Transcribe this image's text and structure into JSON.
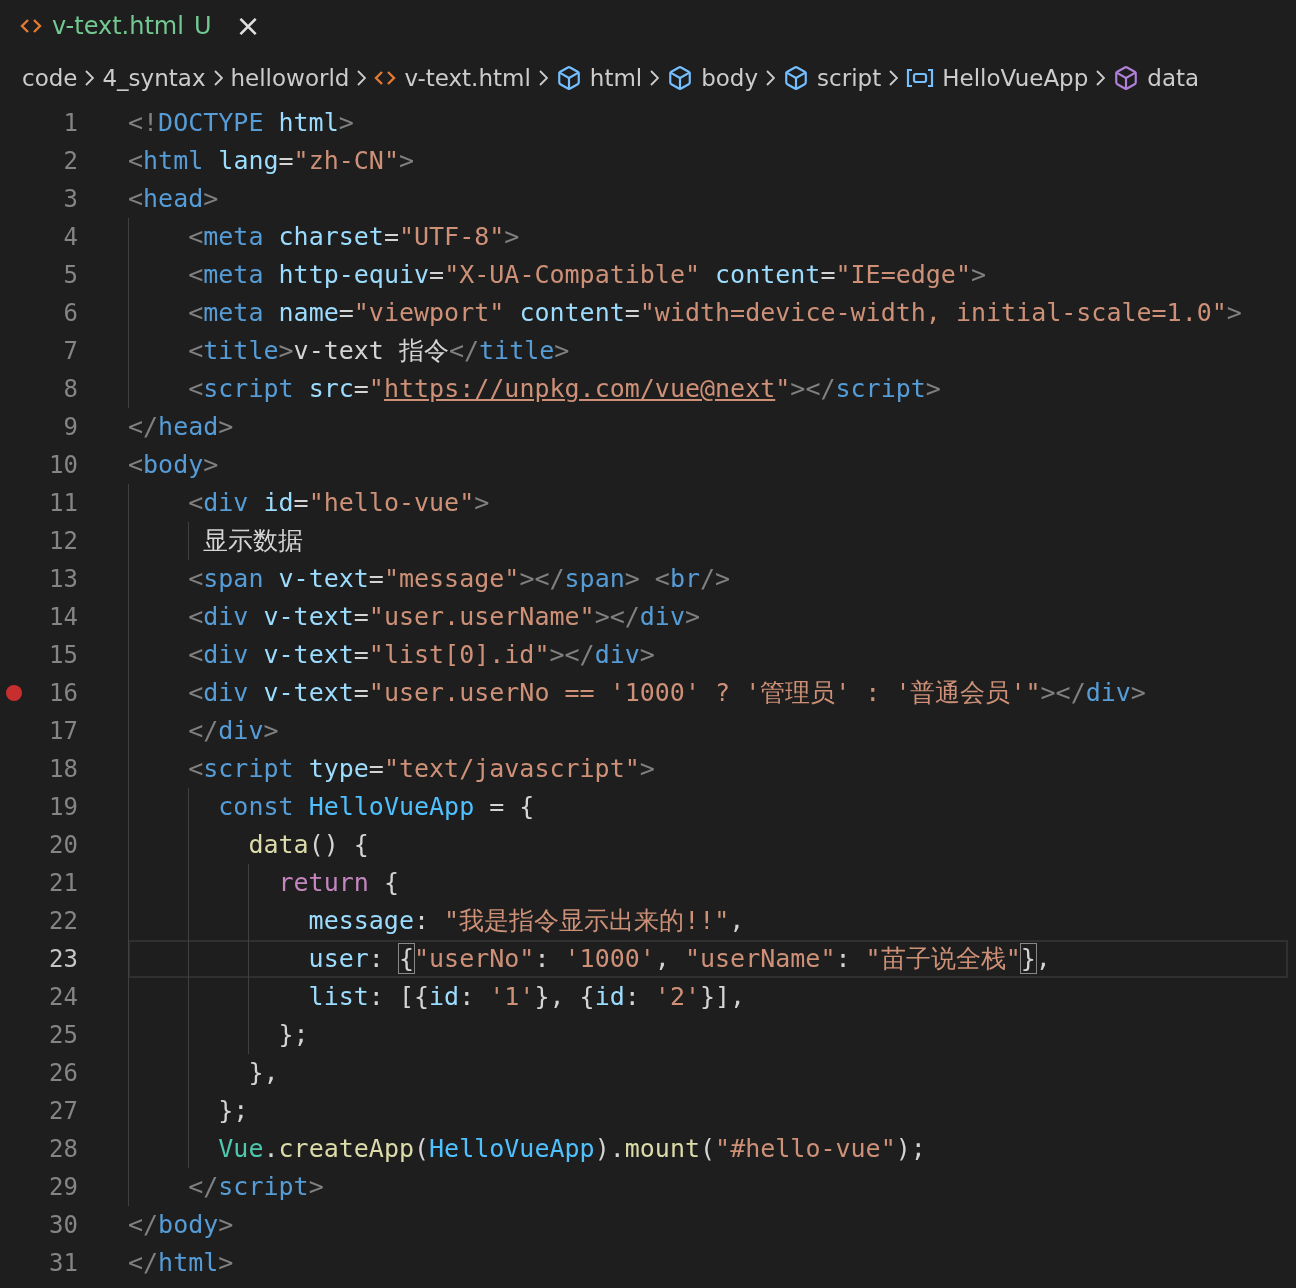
{
  "tab": {
    "label": "v-text.html",
    "status": "U",
    "close": "×",
    "selected": true
  },
  "breadcrumbs": [
    {
      "kind": "folder",
      "label": "code"
    },
    {
      "kind": "folder",
      "label": "4_syntax"
    },
    {
      "kind": "folder",
      "label": "helloworld"
    },
    {
      "kind": "file",
      "label": "v-text.html"
    },
    {
      "kind": "element",
      "label": "html"
    },
    {
      "kind": "element",
      "label": "body"
    },
    {
      "kind": "element",
      "label": "script"
    },
    {
      "kind": "variable",
      "label": "HelloVueApp"
    },
    {
      "kind": "method",
      "label": "data"
    }
  ],
  "lines": [
    {
      "number": "1",
      "breakpoint": false,
      "current": false,
      "tokens": [
        {
          "kind": "punct",
          "text": "<!"
        },
        {
          "kind": "tag",
          "text": "DOCTYPE"
        },
        {
          "kind": "attr",
          "text": " html"
        },
        {
          "kind": "punct",
          "text": ">"
        }
      ]
    },
    {
      "number": "2",
      "breakpoint": false,
      "current": false,
      "tokens": [
        {
          "kind": "punct",
          "text": "<"
        },
        {
          "kind": "tag",
          "text": "html"
        },
        {
          "kind": "attr",
          "text": " lang"
        },
        {
          "kind": "op",
          "text": "="
        },
        {
          "kind": "str",
          "text": "\"zh-CN\""
        },
        {
          "kind": "punct",
          "text": ">"
        }
      ]
    },
    {
      "number": "3",
      "breakpoint": false,
      "current": false,
      "tokens": [
        {
          "kind": "punct",
          "text": "<"
        },
        {
          "kind": "tag",
          "text": "head"
        },
        {
          "kind": "punct",
          "text": ">"
        }
      ]
    },
    {
      "number": "4",
      "breakpoint": false,
      "current": false,
      "tokens": [
        {
          "kind": "punct",
          "text": "    <"
        },
        {
          "kind": "tag",
          "text": "meta"
        },
        {
          "kind": "attr",
          "text": " charset"
        },
        {
          "kind": "op",
          "text": "="
        },
        {
          "kind": "str",
          "text": "\"UTF-8\""
        },
        {
          "kind": "punct",
          "text": ">"
        }
      ]
    },
    {
      "number": "5",
      "breakpoint": false,
      "current": false,
      "tokens": [
        {
          "kind": "punct",
          "text": "    <"
        },
        {
          "kind": "tag",
          "text": "meta"
        },
        {
          "kind": "attr",
          "text": " http-equiv"
        },
        {
          "kind": "op",
          "text": "="
        },
        {
          "kind": "str",
          "text": "\"X-UA-Compatible\""
        },
        {
          "kind": "attr",
          "text": " content"
        },
        {
          "kind": "op",
          "text": "="
        },
        {
          "kind": "str",
          "text": "\"IE=edge\""
        },
        {
          "kind": "punct",
          "text": ">"
        }
      ]
    },
    {
      "number": "6",
      "breakpoint": false,
      "current": false,
      "tokens": [
        {
          "kind": "punct",
          "text": "    <"
        },
        {
          "kind": "tag",
          "text": "meta"
        },
        {
          "kind": "attr",
          "text": " name"
        },
        {
          "kind": "op",
          "text": "="
        },
        {
          "kind": "str",
          "text": "\"viewport\""
        },
        {
          "kind": "attr",
          "text": " content"
        },
        {
          "kind": "op",
          "text": "="
        },
        {
          "kind": "str",
          "text": "\"width=device-width, initial-scale=1.0\""
        },
        {
          "kind": "punct",
          "text": ">"
        }
      ]
    },
    {
      "number": "7",
      "breakpoint": false,
      "current": false,
      "tokens": [
        {
          "kind": "punct",
          "text": "    <"
        },
        {
          "kind": "tag",
          "text": "title"
        },
        {
          "kind": "punct",
          "text": ">"
        },
        {
          "kind": "text",
          "text": "v-text 指令"
        },
        {
          "kind": "punct",
          "text": "</"
        },
        {
          "kind": "tag",
          "text": "title"
        },
        {
          "kind": "punct",
          "text": ">"
        }
      ]
    },
    {
      "number": "8",
      "breakpoint": false,
      "current": false,
      "tokens": [
        {
          "kind": "punct",
          "text": "    <"
        },
        {
          "kind": "tag",
          "text": "script"
        },
        {
          "kind": "attr",
          "text": " src"
        },
        {
          "kind": "op",
          "text": "="
        },
        {
          "kind": "str",
          "text": "\""
        },
        {
          "kind": "link",
          "text": "https://unpkg.com/vue@next"
        },
        {
          "kind": "str",
          "text": "\""
        },
        {
          "kind": "punct",
          "text": "></"
        },
        {
          "kind": "tag",
          "text": "script"
        },
        {
          "kind": "punct",
          "text": ">"
        }
      ]
    },
    {
      "number": "9",
      "breakpoint": false,
      "current": false,
      "tokens": [
        {
          "kind": "punct",
          "text": "</"
        },
        {
          "kind": "tag",
          "text": "head"
        },
        {
          "kind": "punct",
          "text": ">"
        }
      ]
    },
    {
      "number": "10",
      "breakpoint": false,
      "current": false,
      "tokens": [
        {
          "kind": "punct",
          "text": "<"
        },
        {
          "kind": "tag",
          "text": "body"
        },
        {
          "kind": "punct",
          "text": ">"
        }
      ]
    },
    {
      "number": "11",
      "breakpoint": false,
      "current": false,
      "tokens": [
        {
          "kind": "punct",
          "text": "    <"
        },
        {
          "kind": "tag",
          "text": "div"
        },
        {
          "kind": "attr",
          "text": " id"
        },
        {
          "kind": "op",
          "text": "="
        },
        {
          "kind": "str",
          "text": "\"hello-vue\""
        },
        {
          "kind": "punct",
          "text": ">"
        }
      ]
    },
    {
      "number": "12",
      "breakpoint": false,
      "current": false,
      "tokens": [
        {
          "kind": "text",
          "text": "     显示数据"
        }
      ]
    },
    {
      "number": "13",
      "breakpoint": false,
      "current": false,
      "tokens": [
        {
          "kind": "punct",
          "text": "    <"
        },
        {
          "kind": "tag",
          "text": "span"
        },
        {
          "kind": "attr",
          "text": " v-text"
        },
        {
          "kind": "op",
          "text": "="
        },
        {
          "kind": "str",
          "text": "\"message\""
        },
        {
          "kind": "punct",
          "text": "></"
        },
        {
          "kind": "tag",
          "text": "span"
        },
        {
          "kind": "punct",
          "text": "> <"
        },
        {
          "kind": "tag",
          "text": "br"
        },
        {
          "kind": "punct",
          "text": "/>"
        }
      ]
    },
    {
      "number": "14",
      "breakpoint": false,
      "current": false,
      "tokens": [
        {
          "kind": "punct",
          "text": "    <"
        },
        {
          "kind": "tag",
          "text": "div"
        },
        {
          "kind": "attr",
          "text": " v-text"
        },
        {
          "kind": "op",
          "text": "="
        },
        {
          "kind": "str",
          "text": "\"user.userName\""
        },
        {
          "kind": "punct",
          "text": "></"
        },
        {
          "kind": "tag",
          "text": "div"
        },
        {
          "kind": "punct",
          "text": ">"
        }
      ]
    },
    {
      "number": "15",
      "breakpoint": false,
      "current": false,
      "tokens": [
        {
          "kind": "punct",
          "text": "    <"
        },
        {
          "kind": "tag",
          "text": "div"
        },
        {
          "kind": "attr",
          "text": " v-text"
        },
        {
          "kind": "op",
          "text": "="
        },
        {
          "kind": "str",
          "text": "\"list[0].id\""
        },
        {
          "kind": "punct",
          "text": "></"
        },
        {
          "kind": "tag",
          "text": "div"
        },
        {
          "kind": "punct",
          "text": ">"
        }
      ]
    },
    {
      "number": "16",
      "breakpoint": true,
      "current": false,
      "tokens": [
        {
          "kind": "punct",
          "text": "    <"
        },
        {
          "kind": "tag",
          "text": "div"
        },
        {
          "kind": "attr",
          "text": " v-text"
        },
        {
          "kind": "op",
          "text": "="
        },
        {
          "kind": "str",
          "text": "\"user.userNo == '1000' ? '管理员' : '普通会员'\""
        },
        {
          "kind": "punct",
          "text": "></"
        },
        {
          "kind": "tag",
          "text": "div"
        },
        {
          "kind": "punct",
          "text": ">"
        }
      ]
    },
    {
      "number": "17",
      "breakpoint": false,
      "current": false,
      "tokens": [
        {
          "kind": "punct",
          "text": "    </"
        },
        {
          "kind": "tag",
          "text": "div"
        },
        {
          "kind": "punct",
          "text": ">"
        }
      ]
    },
    {
      "number": "18",
      "breakpoint": false,
      "current": false,
      "tokens": [
        {
          "kind": "punct",
          "text": "    <"
        },
        {
          "kind": "tag",
          "text": "script"
        },
        {
          "kind": "attr",
          "text": " type"
        },
        {
          "kind": "op",
          "text": "="
        },
        {
          "kind": "str",
          "text": "\"text/javascript\""
        },
        {
          "kind": "punct",
          "text": ">"
        }
      ]
    },
    {
      "number": "19",
      "breakpoint": false,
      "current": false,
      "tokens": [
        {
          "kind": "kw",
          "text": "      const"
        },
        {
          "kind": "var",
          "text": " HelloVueApp"
        },
        {
          "kind": "op",
          "text": " = {"
        }
      ]
    },
    {
      "number": "20",
      "breakpoint": false,
      "current": false,
      "tokens": [
        {
          "kind": "fn",
          "text": "        data"
        },
        {
          "kind": "op",
          "text": "() {"
        }
      ]
    },
    {
      "number": "21",
      "breakpoint": false,
      "current": false,
      "tokens": [
        {
          "kind": "ctrl",
          "text": "          return"
        },
        {
          "kind": "op",
          "text": " {"
        }
      ]
    },
    {
      "number": "22",
      "breakpoint": false,
      "current": false,
      "tokens": [
        {
          "kind": "prop",
          "text": "            message"
        },
        {
          "kind": "op",
          "text": ": "
        },
        {
          "kind": "str",
          "text": "\"我是指令显示出来的!!\""
        },
        {
          "kind": "op",
          "text": ","
        }
      ]
    },
    {
      "number": "23",
      "breakpoint": false,
      "current": true,
      "tokens": [
        {
          "kind": "prop",
          "text": "            user"
        },
        {
          "kind": "op",
          "text": ": "
        },
        {
          "kind": "match",
          "text": "{"
        },
        {
          "kind": "str",
          "text": "\"userNo\""
        },
        {
          "kind": "op",
          "text": ": "
        },
        {
          "kind": "str",
          "text": "'1000'"
        },
        {
          "kind": "op",
          "text": ", "
        },
        {
          "kind": "str",
          "text": "\"userName\""
        },
        {
          "kind": "op",
          "text": ": "
        },
        {
          "kind": "str",
          "text": "\"苗子说全栈\""
        },
        {
          "kind": "match",
          "text": "}"
        },
        {
          "kind": "op",
          "text": ","
        }
      ]
    },
    {
      "number": "24",
      "breakpoint": false,
      "current": false,
      "tokens": [
        {
          "kind": "prop",
          "text": "            list"
        },
        {
          "kind": "op",
          "text": ": [{"
        },
        {
          "kind": "prop",
          "text": "id"
        },
        {
          "kind": "op",
          "text": ": "
        },
        {
          "kind": "str",
          "text": "'1'"
        },
        {
          "kind": "op",
          "text": "}, {"
        },
        {
          "kind": "prop",
          "text": "id"
        },
        {
          "kind": "op",
          "text": ": "
        },
        {
          "kind": "str",
          "text": "'2'"
        },
        {
          "kind": "op",
          "text": "}],"
        }
      ]
    },
    {
      "number": "25",
      "breakpoint": false,
      "current": false,
      "tokens": [
        {
          "kind": "op",
          "text": "          };"
        }
      ]
    },
    {
      "number": "26",
      "breakpoint": false,
      "current": false,
      "tokens": [
        {
          "kind": "op",
          "text": "        },"
        }
      ]
    },
    {
      "number": "27",
      "breakpoint": false,
      "current": false,
      "tokens": [
        {
          "kind": "op",
          "text": "      };"
        }
      ]
    },
    {
      "number": "28",
      "breakpoint": false,
      "current": false,
      "tokens": [
        {
          "kind": "cls",
          "text": "      Vue"
        },
        {
          "kind": "op",
          "text": "."
        },
        {
          "kind": "fn",
          "text": "createApp"
        },
        {
          "kind": "op",
          "text": "("
        },
        {
          "kind": "var",
          "text": "HelloVueApp"
        },
        {
          "kind": "op",
          "text": ")."
        },
        {
          "kind": "fn",
          "text": "mount"
        },
        {
          "kind": "op",
          "text": "("
        },
        {
          "kind": "str",
          "text": "\"#hello-vue\""
        },
        {
          "kind": "op",
          "text": ");"
        }
      ]
    },
    {
      "number": "29",
      "breakpoint": false,
      "current": false,
      "tokens": [
        {
          "kind": "punct",
          "text": "    </"
        },
        {
          "kind": "tag",
          "text": "script"
        },
        {
          "kind": "punct",
          "text": ">"
        }
      ]
    },
    {
      "number": "30",
      "breakpoint": false,
      "current": false,
      "tokens": [
        {
          "kind": "punct",
          "text": "</"
        },
        {
          "kind": "tag",
          "text": "body"
        },
        {
          "kind": "punct",
          "text": ">"
        }
      ]
    },
    {
      "number": "31",
      "breakpoint": false,
      "current": false,
      "tokens": [
        {
          "kind": "punct",
          "text": "</"
        },
        {
          "kind": "tag",
          "text": "html"
        },
        {
          "kind": "punct",
          "text": ">"
        }
      ]
    }
  ]
}
